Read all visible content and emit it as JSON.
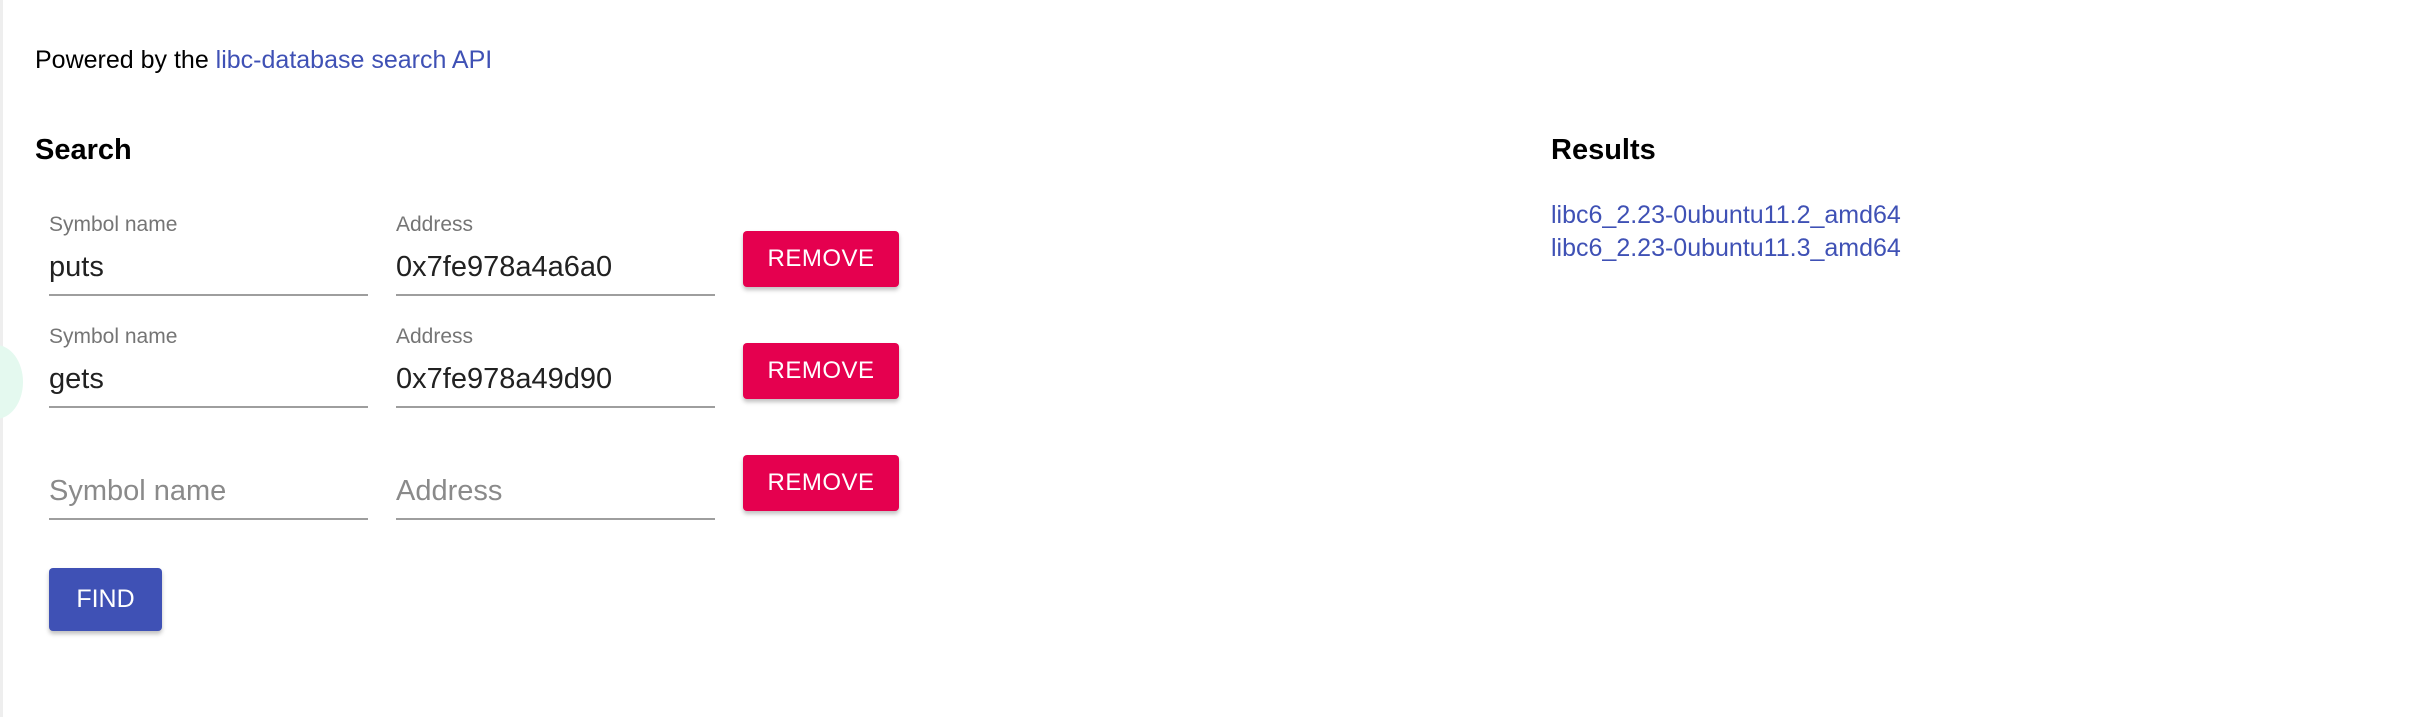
{
  "header": {
    "powered_prefix": "Powered by the ",
    "api_link_text": "libc-database search API"
  },
  "search": {
    "title": "Search",
    "rows": [
      {
        "symbol_label": "Symbol name",
        "symbol_value": "puts",
        "address_label": "Address",
        "address_value": "0x7fe978a4a6a0",
        "remove_label": "REMOVE"
      },
      {
        "symbol_label": "Symbol name",
        "symbol_value": "gets",
        "address_label": "Address",
        "address_value": "0x7fe978a49d90",
        "remove_label": "REMOVE"
      },
      {
        "symbol_placeholder": "Symbol name",
        "symbol_value": "",
        "address_placeholder": "Address",
        "address_value": "",
        "remove_label": "REMOVE"
      }
    ],
    "find_label": "FIND"
  },
  "results": {
    "title": "Results",
    "items": [
      "libc6_2.23-0ubuntu11.2_amd64",
      "libc6_2.23-0ubuntu11.3_amd64"
    ]
  },
  "colors": {
    "link": "#3f51b5",
    "remove_button": "#e5004f",
    "find_button": "#3f51b5"
  }
}
